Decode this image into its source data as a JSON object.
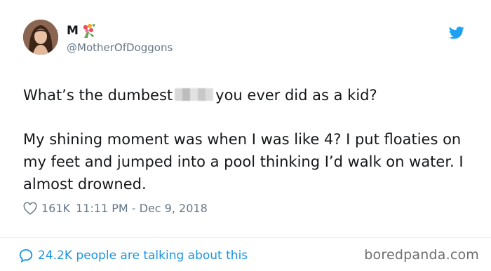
{
  "author": {
    "display_name": "M",
    "emoji_icon": "flower-bouquet-icon",
    "handle": "@MotherOfDoggons",
    "avatar_icon": "profile-photo"
  },
  "tweet": {
    "line1_before": "What’s the dumbest",
    "line1_after": "you ever did as a kid?",
    "paragraph2": "My shining moment was when I was like 4? I put floaties on my feet and jumped into a pool thinking I’d walk on water. I almost drowned."
  },
  "stats": {
    "likes": "161K",
    "timestamp": "11:11 PM - Dec 9, 2018"
  },
  "footer": {
    "talking": "24.2K people are talking about this",
    "watermark": "boredpanda.com"
  },
  "colors": {
    "link": "#1b95e0",
    "twitter_blue": "#1da1f2",
    "muted": "#657786"
  }
}
